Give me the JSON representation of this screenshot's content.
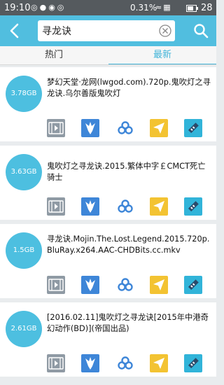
{
  "status_bar": {
    "time": "19:10",
    "battery_percent": "0.31%",
    "battery_level": "28"
  },
  "toolbar": {
    "back_icon": "back-arrow-icon",
    "search_value": "寻龙诀",
    "clear_icon": "clear-circle-icon",
    "search_icon": "search-icon",
    "accent_color": "#51bedf"
  },
  "tabs": [
    {
      "label": "热门",
      "active": false
    },
    {
      "label": "最新",
      "active": true
    }
  ],
  "results": [
    {
      "size": "3.78GB",
      "title": "梦幻天堂·龙网(lwgod.com).720p.鬼吹灯之寻龙诀.乌尔善版鬼吹灯"
    },
    {
      "size": "3.63GB",
      "title": "鬼吹灯之寻龙诀.2015.繁体中字￡CMCT死亡骑士"
    },
    {
      "size": "1.5GB",
      "title": "寻龙诀.Mojin.The.Lost.Legend.2015.720p.BluRay.x264.AAC-CHDBits.cc.mkv"
    },
    {
      "size": "2.61GB",
      "title": "[2016.02.11]鬼吹灯之寻龙诀[2015年中港奇幻动作(BD)](帝国出品)"
    }
  ],
  "action_icons": [
    "play-video-icon",
    "thunder-download-icon",
    "baidu-cloud-icon",
    "send-share-icon",
    "magnet-link-icon"
  ]
}
